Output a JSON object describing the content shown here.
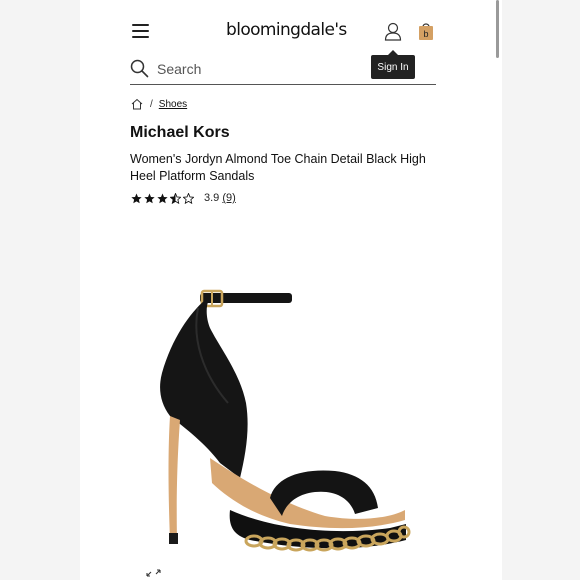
{
  "header": {
    "logo_text": "bloomingdale's",
    "tooltip": "Sign In",
    "icons": {
      "menu": "hamburger-menu-icon",
      "account": "user-account-icon",
      "bag": "shopping-bag-icon",
      "bag_letter": "b"
    },
    "accent_colors": {
      "bag": "#d4a063"
    }
  },
  "search": {
    "placeholder": "Search",
    "value": "",
    "icon": "search-icon"
  },
  "breadcrumb": {
    "home_icon": "home-icon",
    "separator": "/",
    "items": [
      "Shoes"
    ]
  },
  "product": {
    "brand": "Michael Kors",
    "title": "Women's Jordyn Almond Toe Chain Detail Black High Heel Platform Sandals",
    "rating": {
      "value": 3.9,
      "value_text": "3.9",
      "count_text": "(9)",
      "stars_filled": 3.5,
      "stars_total": 5
    },
    "image_icon": "black-platform-sandal-image",
    "expand_icon": "expand-image-icon"
  }
}
